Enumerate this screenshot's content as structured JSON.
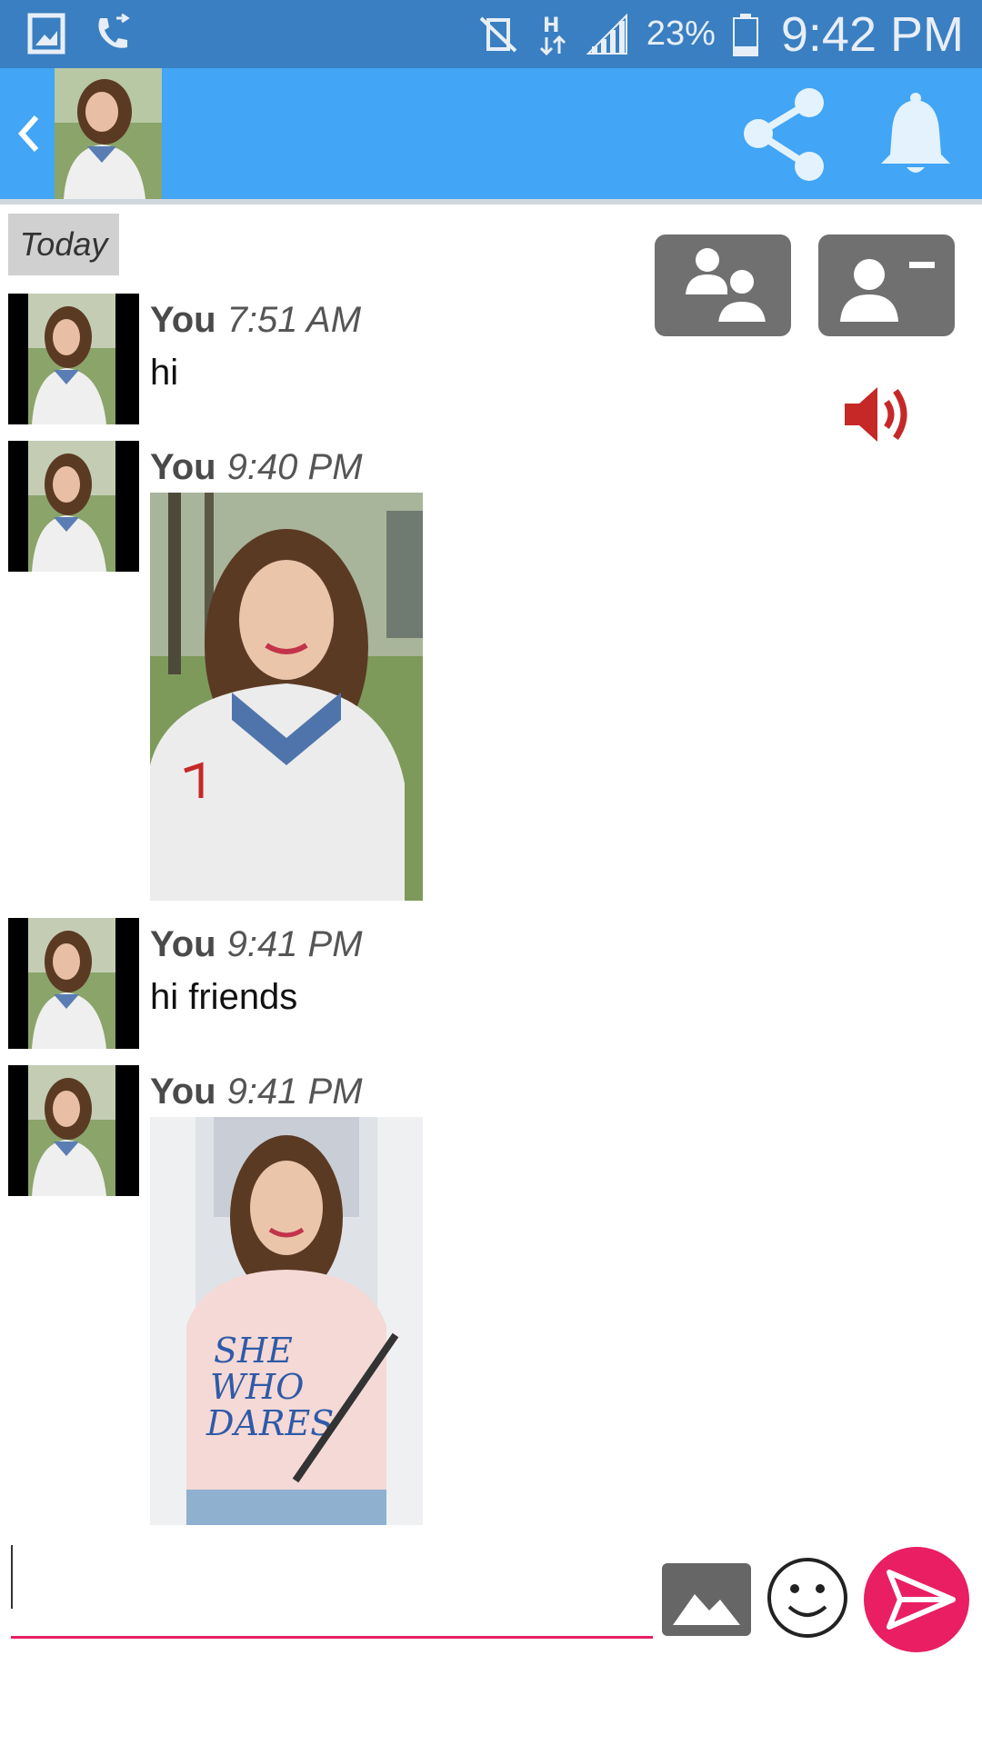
{
  "status_bar": {
    "battery_percent": "23%",
    "time": "9:42 PM",
    "icons": [
      "gallery-icon",
      "call-icon",
      "vibrate-off-icon",
      "hspa-data-icon",
      "signal-icon",
      "battery-icon"
    ]
  },
  "header": {
    "back_icon": "chevron-left-icon",
    "actions": [
      "share-icon",
      "bell-icon"
    ]
  },
  "chat": {
    "date_label": "Today",
    "messages": [
      {
        "sender": "You",
        "time": "7:51 AM",
        "text": "hi"
      },
      {
        "sender": "You",
        "time": "9:40 PM",
        "image": "photo-woman-white-sweater"
      },
      {
        "sender": "You",
        "time": "9:41 PM",
        "text": "hi friends"
      },
      {
        "sender": "You",
        "time": "9:41 PM",
        "image": "photo-woman-pink-tshirt"
      }
    ]
  },
  "side_actions": [
    "group-users-icon",
    "remove-user-icon",
    "speaker-icon"
  ],
  "composer": {
    "input_value": "",
    "buttons": [
      "image-attach-icon",
      "emoji-icon",
      "send-icon"
    ]
  },
  "colors": {
    "status_bar": "#3a7fc1",
    "app_bar": "#42a5f5",
    "accent": "#e91e63",
    "speaker": "#c62828"
  }
}
